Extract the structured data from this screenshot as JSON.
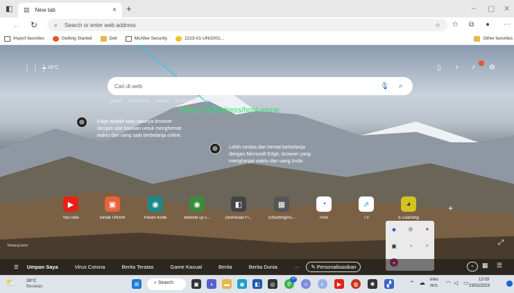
{
  "browser": {
    "tab_title": "New tab",
    "tab_close": "×",
    "new_tab": "+",
    "address_placeholder": "Search or enter web address",
    "win_min": "–",
    "win_restore": "▢",
    "win_close": "✕"
  },
  "favorites": [
    {
      "label": "Import favorites",
      "color": "#555555"
    },
    {
      "label": "Getting Started",
      "color": "#e05a1e"
    },
    {
      "label": "Dell",
      "color": "#e8b74a"
    },
    {
      "label": "McAfee Security",
      "color": "#ffffff"
    },
    {
      "label": "2223-01-UNI1001...",
      "color": "#f2c12e"
    }
  ],
  "other_favorites": "Other favorites",
  "annotation": "Search Ip Address/host name",
  "newtab": {
    "weather": "28°C",
    "search_placeholder": "Cari di web",
    "quicklinks": [
      "google",
      "pdf to word",
      "yandex",
      "word to pdf",
      "ssh ubuntu",
      "..."
    ],
    "tip1": [
      "Edge adalah satu-satunya browser",
      "dengan alat bawaan untuk menghemat",
      "waktu dan uang saat berbelanja online."
    ],
    "tip2": [
      "Lebih cerdas dan hemat berbelanja",
      "dengan Microsoft Edge, browser yang",
      "menghargai waktu dan uang Anda"
    ],
    "credit": "Tentang kami",
    "tiles": [
      {
        "label": "YouTube",
        "glyph": "▶",
        "color": "#e62117"
      },
      {
        "label": "Simak UNSRI",
        "glyph": "▣",
        "color": "#e8643c"
      },
      {
        "label": "Petani Kode",
        "glyph": "◉",
        "color": "#1a8a8a"
      },
      {
        "label": "website uji c...",
        "glyph": "◉",
        "color": "#3c8a3c"
      },
      {
        "label": "Download Fr...",
        "glyph": "◧",
        "color": "#444444"
      },
      {
        "label": "10fastfingers...",
        "glyph": "▦",
        "color": "#555555"
      },
      {
        "label": "Polo",
        "glyph": "◔",
        "color": "#1e5aa8"
      },
      {
        "label": "TV",
        "glyph": "⇗",
        "color": "#1eaac8"
      },
      {
        "label": "E-Learning",
        "glyph": "◕",
        "color": "#d6c21e"
      }
    ],
    "bottom_nav": [
      "Umpan Saya",
      "Virus Corona",
      "Berita Teratas",
      "Game Kasual",
      "Berita",
      "Berita Dunia"
    ],
    "personalize": "Personalisasikan"
  },
  "taskbar": {
    "weather_temp": "28°C",
    "weather_desc": "Berawan",
    "search": "Search",
    "lang_1": "ENG",
    "lang_2": "INTL",
    "time": "12:03",
    "date": "23/02/2023",
    "notif_count": "10"
  }
}
